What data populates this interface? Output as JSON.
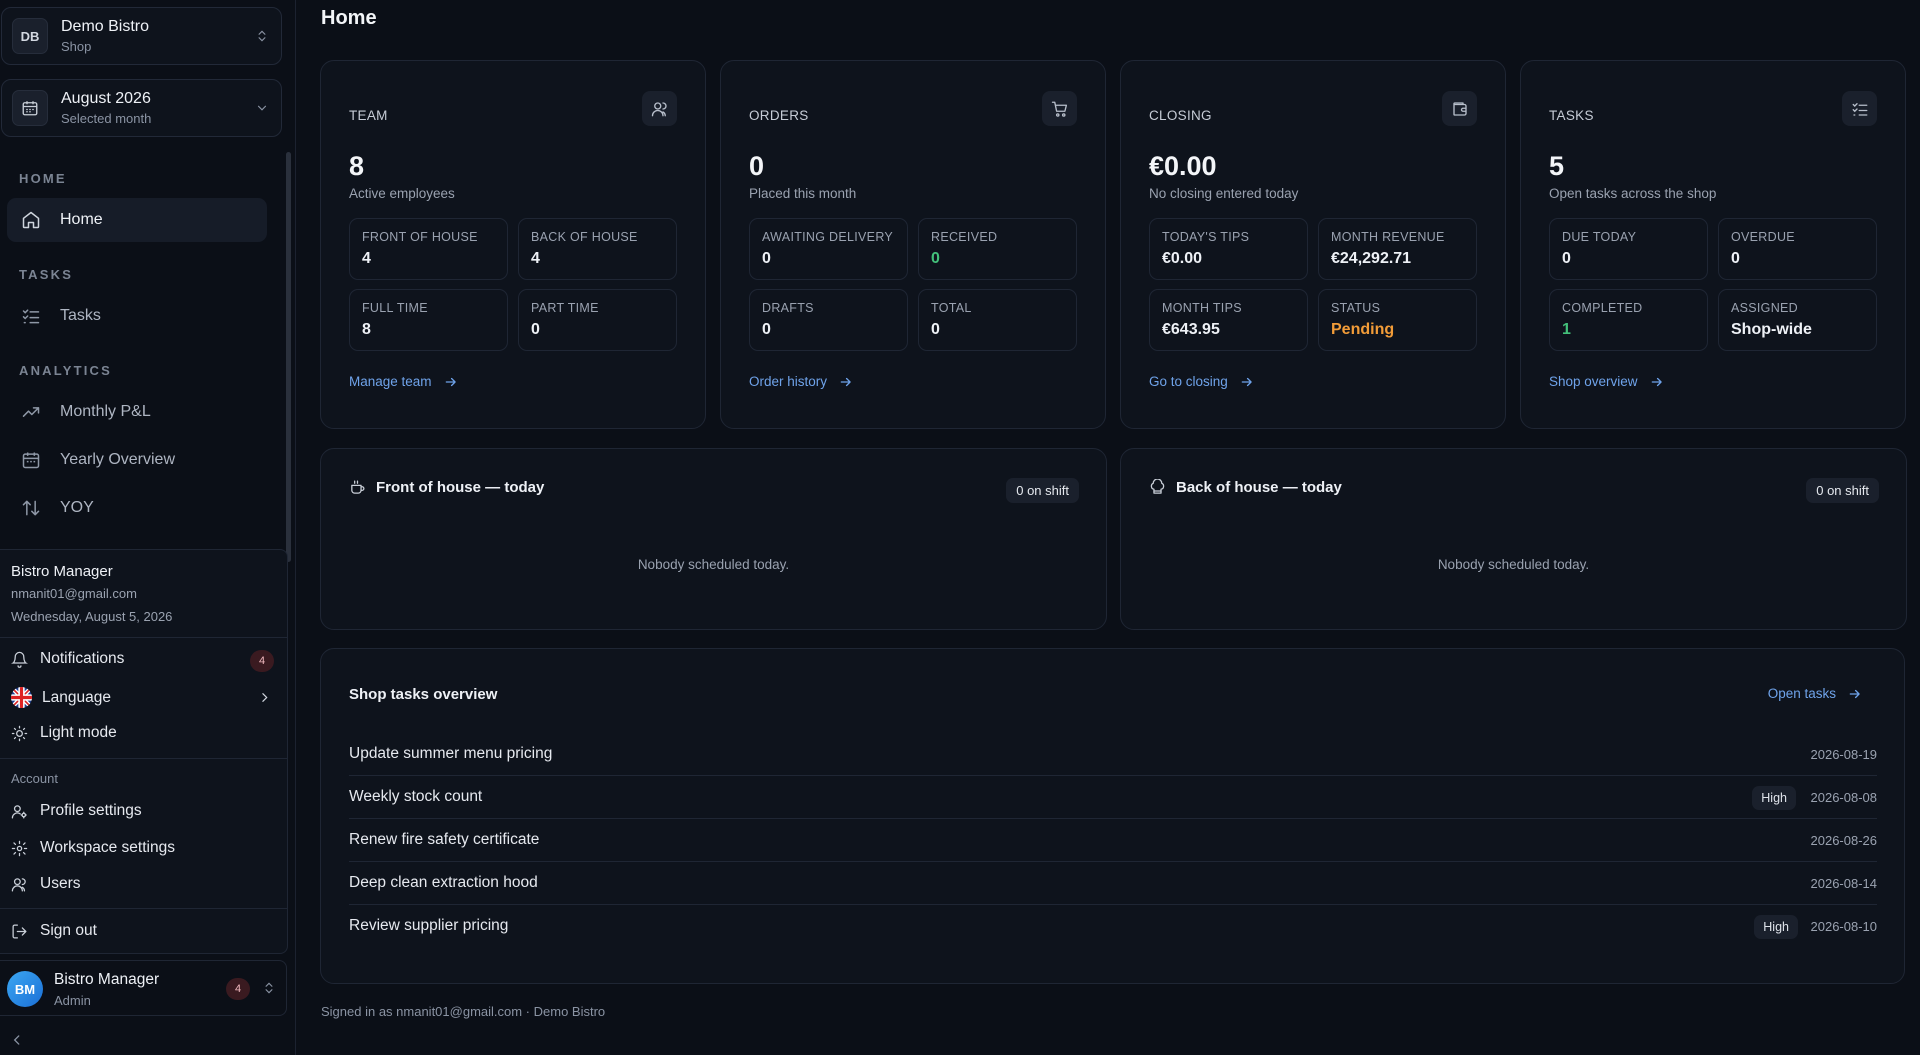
{
  "shop_switcher": {
    "initials": "DB",
    "name": "Demo Bistro",
    "type": "Shop"
  },
  "month_switcher": {
    "month": "August 2026",
    "caption": "Selected month"
  },
  "nav": {
    "home_section": "HOME",
    "home": "Home",
    "tasks_section": "TASKS",
    "tasks": "Tasks",
    "analytics_section": "ANALYTICS",
    "monthly_pl": "Monthly P&L",
    "yearly_overview": "Yearly Overview",
    "yoy": "YOY"
  },
  "user_menu": {
    "name": "Bistro Manager",
    "email": "nmanit01@gmail.com",
    "date": "Wednesday, August 5, 2026",
    "notifications": "Notifications",
    "notifications_count": "4",
    "language": "Language",
    "light_mode": "Light mode",
    "account_label": "Account",
    "profile_settings": "Profile settings",
    "workspace_settings": "Workspace settings",
    "users": "Users",
    "sign_out": "Sign out"
  },
  "bottom_user": {
    "initials": "BM",
    "name": "Bistro Manager",
    "role": "Admin",
    "count": "4"
  },
  "page": {
    "title": "Home"
  },
  "cards": {
    "team": {
      "title": "TEAM",
      "value": "8",
      "sub": "Active employees",
      "stats": [
        {
          "label": "FRONT OF HOUSE",
          "value": "4"
        },
        {
          "label": "BACK OF HOUSE",
          "value": "4"
        },
        {
          "label": "FULL TIME",
          "value": "8"
        },
        {
          "label": "PART TIME",
          "value": "0"
        }
      ],
      "link": "Manage team"
    },
    "orders": {
      "title": "ORDERS",
      "value": "0",
      "sub": "Placed this month",
      "stats": [
        {
          "label": "AWAITING DELIVERY",
          "value": "0"
        },
        {
          "label": "RECEIVED",
          "value": "0"
        },
        {
          "label": "DRAFTS",
          "value": "0"
        },
        {
          "label": "TOTAL",
          "value": "0"
        }
      ],
      "link": "Order history"
    },
    "closing": {
      "title": "CLOSING",
      "value": "€0.00",
      "sub": "No closing entered today",
      "stats": [
        {
          "label": "TODAY'S TIPS",
          "value": "€0.00"
        },
        {
          "label": "MONTH REVENUE",
          "value": "€24,292.71"
        },
        {
          "label": "MONTH TIPS",
          "value": "€643.95"
        },
        {
          "label": "STATUS",
          "value": "Pending"
        }
      ],
      "link": "Go to closing"
    },
    "tasks": {
      "title": "TASKS",
      "value": "5",
      "sub": "Open tasks across the shop",
      "stats": [
        {
          "label": "DUE TODAY",
          "value": "0"
        },
        {
          "label": "OVERDUE",
          "value": "0"
        },
        {
          "label": "COMPLETED",
          "value": "1"
        },
        {
          "label": "ASSIGNED",
          "value": "Shop-wide"
        }
      ],
      "link": "Shop overview"
    }
  },
  "front_of_house": {
    "title": "Front of house — today",
    "pill": "0 on shift",
    "empty": "Nobody scheduled today."
  },
  "back_of_house": {
    "title": "Back of house — today",
    "pill": "0 on shift",
    "empty": "Nobody scheduled today."
  },
  "shop_tasks": {
    "title": "Shop tasks overview",
    "open_link": "Open tasks",
    "rows": [
      {
        "name": "Update summer menu pricing",
        "priority": "",
        "date": "2026-08-19"
      },
      {
        "name": "Weekly stock count",
        "priority": "High",
        "date": "2026-08-08"
      },
      {
        "name": "Renew fire safety certificate",
        "priority": "",
        "date": "2026-08-26"
      },
      {
        "name": "Deep clean extraction hood",
        "priority": "",
        "date": "2026-08-14"
      },
      {
        "name": "Review supplier pricing",
        "priority": "High",
        "date": "2026-08-10"
      }
    ]
  },
  "footer": {
    "text": "Signed in as nmanit01@gmail.com · Demo Bistro"
  },
  "colors": {
    "accent_link": "#6fa3ea",
    "success": "#43c07a",
    "warning": "#f29c38",
    "background": "#0b0f17"
  }
}
